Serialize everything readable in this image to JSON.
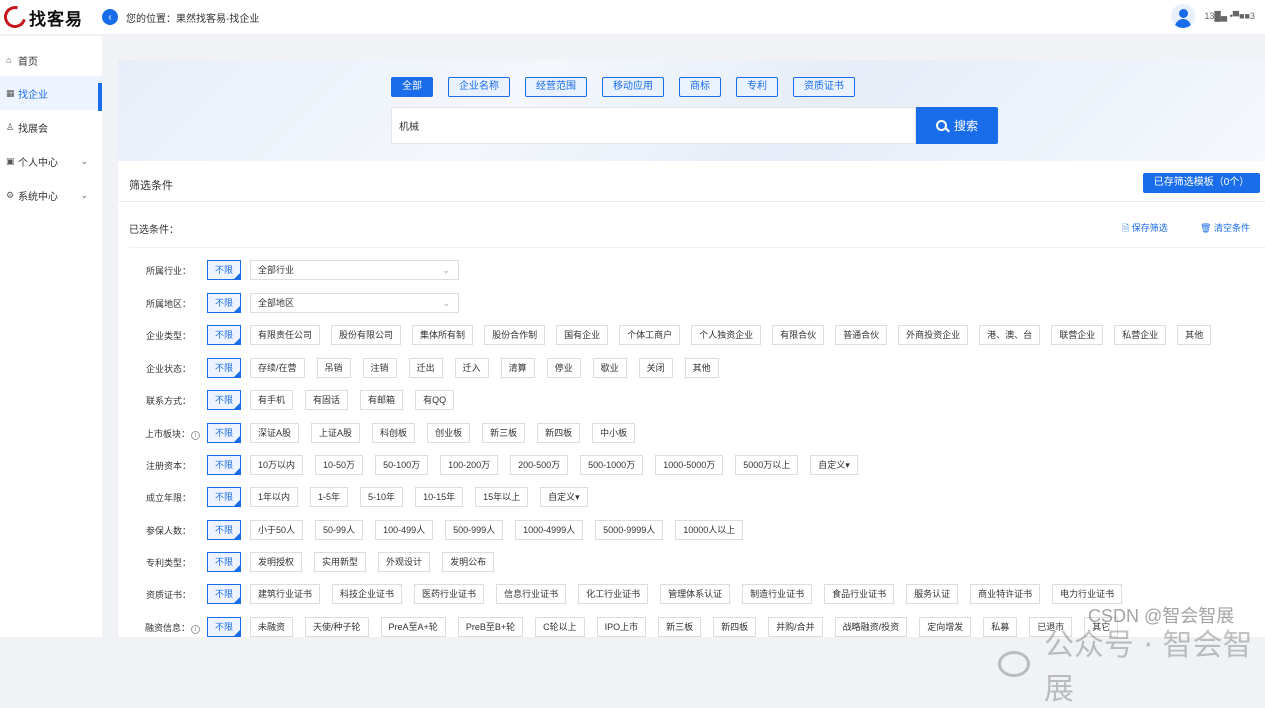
{
  "header": {
    "logo_text": "找客易",
    "breadcrumb": "您的位置：果然找客易-找企业",
    "phone": "13█▄ •▀■■3"
  },
  "sidebar": {
    "items": [
      {
        "icon": "home-icon",
        "label": "首页"
      },
      {
        "icon": "building-icon",
        "label": "找企业"
      },
      {
        "icon": "expo-icon",
        "label": "找展会"
      },
      {
        "icon": "person-icon",
        "label": "个人中心"
      },
      {
        "icon": "gear-icon",
        "label": "系统中心"
      }
    ]
  },
  "search": {
    "tabs": [
      "全部",
      "企业名称",
      "经营范围",
      "移动应用",
      "商标",
      "专利",
      "资质证书"
    ],
    "active_tab": "全部",
    "value": "机械",
    "button": "搜索"
  },
  "filter": {
    "title": "筛选条件",
    "template_button": "已存筛选模板（0个）",
    "selected_label": "已选条件：",
    "save_label": "保存筛选",
    "clear_label": "清空条件",
    "no_limit": "不限",
    "rows": [
      {
        "label": "所属行业：",
        "select": "全部行业"
      },
      {
        "label": "所属地区：",
        "select": "全部地区"
      },
      {
        "label": "企业类型：",
        "options": [
          "有限责任公司",
          "股份有限公司",
          "集体所有制",
          "股份合作制",
          "国有企业",
          "个体工商户",
          "个人独资企业",
          "有限合伙",
          "普通合伙",
          "外商投资企业",
          "港、澳、台",
          "联营企业",
          "私营企业",
          "其他"
        ]
      },
      {
        "label": "企业状态：",
        "options": [
          "存续/在营",
          "吊销",
          "注销",
          "迁出",
          "迁入",
          "清算",
          "停业",
          "歇业",
          "关闭",
          "其他"
        ]
      },
      {
        "label": "联系方式：",
        "options": [
          "有手机",
          "有固话",
          "有邮箱",
          "有QQ"
        ]
      },
      {
        "label": "上市板块：",
        "info": "i",
        "options": [
          "深证A股",
          "上证A股",
          "科创板",
          "创业板",
          "新三板",
          "新四板",
          "中小板"
        ]
      },
      {
        "label": "注册资本：",
        "options": [
          "10万以内",
          "10-50万",
          "50-100万",
          "100-200万",
          "200-500万",
          "500-1000万",
          "1000-5000万",
          "5000万以上"
        ],
        "custom": "自定义▾"
      },
      {
        "label": "成立年限：",
        "options": [
          "1年以内",
          "1-5年",
          "5-10年",
          "10-15年",
          "15年以上"
        ],
        "custom": "自定义▾"
      },
      {
        "label": "参保人数：",
        "options": [
          "小于50人",
          "50-99人",
          "100-499人",
          "500-999人",
          "1000-4999人",
          "5000-9999人",
          "10000人以上"
        ]
      },
      {
        "label": "专利类型：",
        "options": [
          "发明授权",
          "实用新型",
          "外观设计",
          "发明公布"
        ]
      },
      {
        "label": "资质证书：",
        "options": [
          "建筑行业证书",
          "科技企业证书",
          "医药行业证书",
          "信息行业证书",
          "化工行业证书",
          "管理体系认证",
          "制造行业证书",
          "食品行业证书",
          "服务认证",
          "商业特许证书",
          "电力行业证书"
        ]
      },
      {
        "label": "融资信息：",
        "info": "i",
        "options": [
          "未融资",
          "天使/种子轮",
          "PreA至A+轮",
          "PreB至B+轮",
          "C轮以上",
          "IPO上市",
          "新三板",
          "新四板",
          "并购/合并",
          "战略融资/投资",
          "定向增发",
          "私募",
          "已退市",
          "其它"
        ]
      }
    ]
  },
  "watermark": {
    "text": "公众号 · 智会智展",
    "csdn": "CSDN @智会智展"
  },
  "colors": {
    "accent": "#1a6dea",
    "brand_red": "#c8161e"
  }
}
